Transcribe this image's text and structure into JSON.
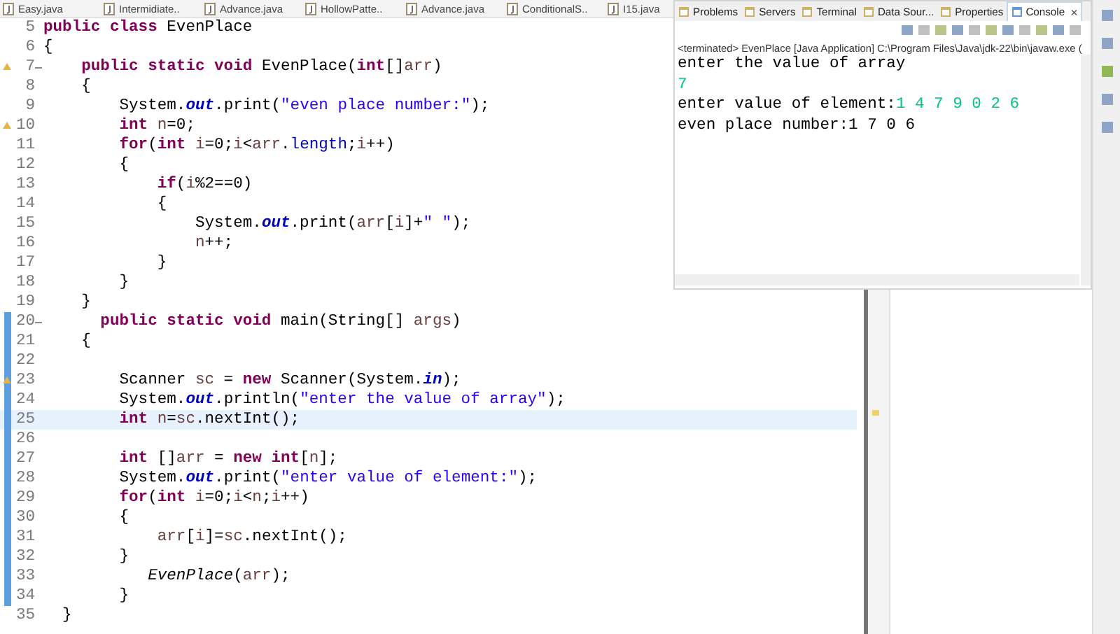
{
  "editor_tabs": [
    {
      "label": "Easy.java"
    },
    {
      "label": "Intermidiate.."
    },
    {
      "label": "Advance.java"
    },
    {
      "label": "HollowPatte.."
    },
    {
      "label": "Advance.java"
    },
    {
      "label": "ConditionalS.."
    },
    {
      "label": "I15.java"
    }
  ],
  "code_lines": [
    {
      "number": "5",
      "warning": false,
      "fold": false,
      "in_range": false,
      "current": false,
      "tokens": [
        {
          "kind": "kw",
          "text": "public class "
        },
        {
          "kind": "plain",
          "text": "EvenPlace"
        }
      ]
    },
    {
      "number": "6",
      "warning": false,
      "fold": false,
      "in_range": false,
      "current": false,
      "tokens": [
        {
          "kind": "plain",
          "text": "{"
        }
      ]
    },
    {
      "number": "7",
      "warning": true,
      "fold": true,
      "in_range": false,
      "current": false,
      "tokens": [
        {
          "kind": "kw",
          "text": "    public static void "
        },
        {
          "kind": "plain",
          "text": "EvenPlace("
        },
        {
          "kind": "kw",
          "text": "int"
        },
        {
          "kind": "plain",
          "text": "[]"
        },
        {
          "kind": "var",
          "text": "arr"
        },
        {
          "kind": "plain",
          "text": ")"
        }
      ]
    },
    {
      "number": "8",
      "warning": false,
      "fold": false,
      "in_range": false,
      "current": false,
      "tokens": [
        {
          "kind": "plain",
          "text": "    {"
        }
      ]
    },
    {
      "number": "9",
      "warning": false,
      "fold": false,
      "in_range": false,
      "current": false,
      "tokens": [
        {
          "kind": "plain",
          "text": "        System."
        },
        {
          "kind": "field",
          "text": "out"
        },
        {
          "kind": "plain",
          "text": ".print("
        },
        {
          "kind": "str",
          "text": "\"even place number:\""
        },
        {
          "kind": "plain",
          "text": ");"
        }
      ]
    },
    {
      "number": "10",
      "warning": true,
      "fold": false,
      "in_range": false,
      "current": false,
      "tokens": [
        {
          "kind": "kw",
          "text": "        int "
        },
        {
          "kind": "var",
          "text": "n"
        },
        {
          "kind": "plain",
          "text": "=0;"
        }
      ]
    },
    {
      "number": "11",
      "warning": false,
      "fold": false,
      "in_range": false,
      "current": false,
      "tokens": [
        {
          "kind": "kw",
          "text": "        for"
        },
        {
          "kind": "plain",
          "text": "("
        },
        {
          "kind": "kw",
          "text": "int "
        },
        {
          "kind": "var",
          "text": "i"
        },
        {
          "kind": "plain",
          "text": "=0;"
        },
        {
          "kind": "var",
          "text": "i"
        },
        {
          "kind": "plain",
          "text": "<"
        },
        {
          "kind": "var",
          "text": "arr"
        },
        {
          "kind": "plain",
          "text": "."
        },
        {
          "kind": "member",
          "text": "length"
        },
        {
          "kind": "plain",
          "text": ";"
        },
        {
          "kind": "var",
          "text": "i"
        },
        {
          "kind": "plain",
          "text": "++)"
        }
      ]
    },
    {
      "number": "12",
      "warning": false,
      "fold": false,
      "in_range": false,
      "current": false,
      "tokens": [
        {
          "kind": "plain",
          "text": "        {"
        }
      ]
    },
    {
      "number": "13",
      "warning": false,
      "fold": false,
      "in_range": false,
      "current": false,
      "tokens": [
        {
          "kind": "kw",
          "text": "            if"
        },
        {
          "kind": "plain",
          "text": "("
        },
        {
          "kind": "var",
          "text": "i"
        },
        {
          "kind": "plain",
          "text": "%2==0)"
        }
      ]
    },
    {
      "number": "14",
      "warning": false,
      "fold": false,
      "in_range": false,
      "current": false,
      "tokens": [
        {
          "kind": "plain",
          "text": "            {"
        }
      ]
    },
    {
      "number": "15",
      "warning": false,
      "fold": false,
      "in_range": false,
      "current": false,
      "tokens": [
        {
          "kind": "plain",
          "text": "                System."
        },
        {
          "kind": "field",
          "text": "out"
        },
        {
          "kind": "plain",
          "text": ".print("
        },
        {
          "kind": "var",
          "text": "arr"
        },
        {
          "kind": "plain",
          "text": "["
        },
        {
          "kind": "var",
          "text": "i"
        },
        {
          "kind": "plain",
          "text": "]+"
        },
        {
          "kind": "str",
          "text": "\" \""
        },
        {
          "kind": "plain",
          "text": ");"
        }
      ]
    },
    {
      "number": "16",
      "warning": false,
      "fold": false,
      "in_range": false,
      "current": false,
      "tokens": [
        {
          "kind": "var",
          "text": "                n"
        },
        {
          "kind": "plain",
          "text": "++;"
        }
      ]
    },
    {
      "number": "17",
      "warning": false,
      "fold": false,
      "in_range": false,
      "current": false,
      "tokens": [
        {
          "kind": "plain",
          "text": "            }"
        }
      ]
    },
    {
      "number": "18",
      "warning": false,
      "fold": false,
      "in_range": false,
      "current": false,
      "tokens": [
        {
          "kind": "plain",
          "text": "        }"
        }
      ]
    },
    {
      "number": "19",
      "warning": false,
      "fold": false,
      "in_range": false,
      "current": false,
      "tokens": [
        {
          "kind": "plain",
          "text": "    }"
        }
      ]
    },
    {
      "number": "20",
      "warning": false,
      "fold": true,
      "in_range": true,
      "current": false,
      "tokens": [
        {
          "kind": "kw",
          "text": "      public static void "
        },
        {
          "kind": "plain",
          "text": "main(String[] "
        },
        {
          "kind": "var",
          "text": "args"
        },
        {
          "kind": "plain",
          "text": ")"
        }
      ]
    },
    {
      "number": "21",
      "warning": false,
      "fold": false,
      "in_range": true,
      "current": false,
      "tokens": [
        {
          "kind": "plain",
          "text": "    {"
        }
      ]
    },
    {
      "number": "22",
      "warning": false,
      "fold": false,
      "in_range": true,
      "current": false
    },
    {
      "number": "23",
      "warning": true,
      "fold": false,
      "in_range": true,
      "current": false,
      "tokens": [
        {
          "kind": "plain",
          "text": "        Scanner "
        },
        {
          "kind": "var",
          "text": "sc"
        },
        {
          "kind": "plain",
          "text": " = "
        },
        {
          "kind": "kw",
          "text": "new "
        },
        {
          "kind": "plain",
          "text": "Scanner(System."
        },
        {
          "kind": "field",
          "text": "in"
        },
        {
          "kind": "plain",
          "text": ");"
        }
      ]
    },
    {
      "number": "24",
      "warning": false,
      "fold": false,
      "in_range": true,
      "current": false,
      "tokens": [
        {
          "kind": "plain",
          "text": "        System."
        },
        {
          "kind": "field",
          "text": "out"
        },
        {
          "kind": "plain",
          "text": ".println("
        },
        {
          "kind": "str",
          "text": "\"enter the value of array\""
        },
        {
          "kind": "plain",
          "text": ");"
        }
      ]
    },
    {
      "number": "25",
      "warning": false,
      "fold": false,
      "in_range": true,
      "current": true,
      "tokens": [
        {
          "kind": "kw",
          "text": "        int "
        },
        {
          "kind": "var",
          "text": "n"
        },
        {
          "kind": "plain",
          "text": "="
        },
        {
          "kind": "var",
          "text": "sc"
        },
        {
          "kind": "plain",
          "text": ".nextInt();"
        }
      ]
    },
    {
      "number": "26",
      "warning": false,
      "fold": false,
      "in_range": true,
      "current": false
    },
    {
      "number": "27",
      "warning": false,
      "fold": false,
      "in_range": true,
      "current": false,
      "tokens": [
        {
          "kind": "kw",
          "text": "        int "
        },
        {
          "kind": "plain",
          "text": "[]"
        },
        {
          "kind": "var",
          "text": "arr"
        },
        {
          "kind": "plain",
          "text": " = "
        },
        {
          "kind": "kw",
          "text": "new int"
        },
        {
          "kind": "plain",
          "text": "["
        },
        {
          "kind": "var",
          "text": "n"
        },
        {
          "kind": "plain",
          "text": "];"
        }
      ]
    },
    {
      "number": "28",
      "warning": false,
      "fold": false,
      "in_range": true,
      "current": false,
      "tokens": [
        {
          "kind": "plain",
          "text": "        System."
        },
        {
          "kind": "field",
          "text": "out"
        },
        {
          "kind": "plain",
          "text": ".print("
        },
        {
          "kind": "str",
          "text": "\"enter value of element:\""
        },
        {
          "kind": "plain",
          "text": ");"
        }
      ]
    },
    {
      "number": "29",
      "warning": false,
      "fold": false,
      "in_range": true,
      "current": false,
      "tokens": [
        {
          "kind": "kw",
          "text": "        for"
        },
        {
          "kind": "plain",
          "text": "("
        },
        {
          "kind": "kw",
          "text": "int "
        },
        {
          "kind": "var",
          "text": "i"
        },
        {
          "kind": "plain",
          "text": "=0;"
        },
        {
          "kind": "var",
          "text": "i"
        },
        {
          "kind": "plain",
          "text": "<"
        },
        {
          "kind": "var",
          "text": "n"
        },
        {
          "kind": "plain",
          "text": ";"
        },
        {
          "kind": "var",
          "text": "i"
        },
        {
          "kind": "plain",
          "text": "++)"
        }
      ]
    },
    {
      "number": "30",
      "warning": false,
      "fold": false,
      "in_range": true,
      "current": false,
      "tokens": [
        {
          "kind": "plain",
          "text": "        {"
        }
      ]
    },
    {
      "number": "31",
      "warning": false,
      "fold": false,
      "in_range": true,
      "current": false,
      "tokens": [
        {
          "kind": "var",
          "text": "            arr"
        },
        {
          "kind": "plain",
          "text": "["
        },
        {
          "kind": "var",
          "text": "i"
        },
        {
          "kind": "plain",
          "text": "]="
        },
        {
          "kind": "var",
          "text": "sc"
        },
        {
          "kind": "plain",
          "text": ".nextInt();"
        }
      ]
    },
    {
      "number": "32",
      "warning": false,
      "fold": false,
      "in_range": true,
      "current": false,
      "tokens": [
        {
          "kind": "plain",
          "text": "        }"
        }
      ]
    },
    {
      "number": "33",
      "warning": false,
      "fold": false,
      "in_range": true,
      "current": false,
      "tokens": [
        {
          "kind": "static",
          "text": "           EvenPlace"
        },
        {
          "kind": "plain",
          "text": "("
        },
        {
          "kind": "var",
          "text": "arr"
        },
        {
          "kind": "plain",
          "text": ");"
        }
      ]
    },
    {
      "number": "34",
      "warning": false,
      "fold": false,
      "in_range": true,
      "current": false,
      "tokens": [
        {
          "kind": "plain",
          "text": "        }"
        }
      ]
    },
    {
      "number": "35",
      "warning": false,
      "fold": false,
      "in_range": false,
      "current": false,
      "tokens": [
        {
          "kind": "plain",
          "text": "  }"
        }
      ]
    }
  ],
  "console": {
    "tabs": [
      {
        "label": "Problems",
        "selected": false
      },
      {
        "label": "Servers",
        "selected": false
      },
      {
        "label": "Terminal",
        "selected": false
      },
      {
        "label": "Data Sour...",
        "selected": false
      },
      {
        "label": "Properties",
        "selected": false
      },
      {
        "label": "Console",
        "selected": true,
        "closable": true
      }
    ],
    "close_glyph": "×",
    "launch": "<terminated> EvenPlace [Java Application] C:\\Program Files\\Java\\jdk-22\\bin\\javaw.exe  (",
    "output": [
      [
        {
          "kind": "out",
          "text": "enter the value of array"
        }
      ],
      [
        {
          "kind": "in",
          "text": "7"
        }
      ],
      [
        {
          "kind": "out",
          "text": "enter value of element:"
        },
        {
          "kind": "in",
          "text": "1 4 7 9 0 2 6"
        }
      ],
      [
        {
          "kind": "out",
          "text": "even place number:1 7 0 6"
        }
      ]
    ]
  }
}
